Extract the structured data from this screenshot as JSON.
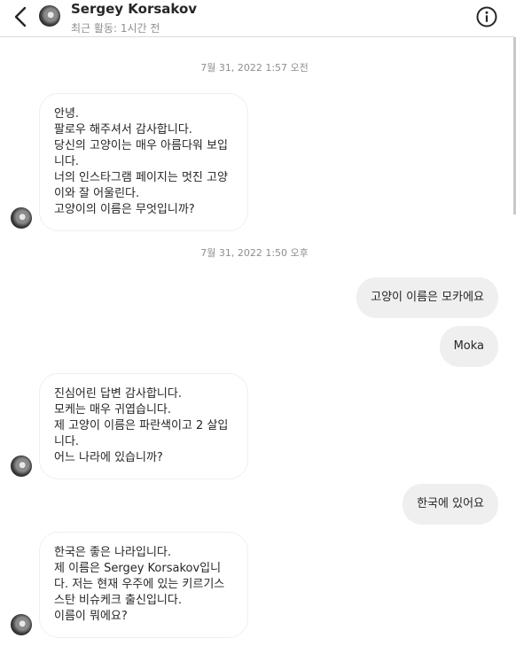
{
  "header": {
    "name": "Sergey Korsakov",
    "status": "최근 활동: 1시간 전",
    "icons": [
      "chevron-left-icon",
      "info-icon"
    ]
  },
  "timestamps": [
    "7월 31, 2022 1:57 오전",
    "7월 31, 2022 1:50 오후"
  ],
  "messages": [
    {
      "sender": "Sergey Korsakov",
      "text": "안녕.\n팔로우 해주셔서 감사합니다.\n당신의 고양이는 매우 아름다워 보입니다.\n너의 인스타그램 페이지는 멋진 고양이와 잘 어울린다.\n고양이의 이름은 무엇입니까?"
    },
    {
      "sender": "me",
      "text": "고양이 이름은 모카에요"
    },
    {
      "sender": "me",
      "text": "Moka"
    },
    {
      "sender": "Sergey Korsakov",
      "text": "진심어린 답변 감사합니다.\n모케는 매우 귀엽습니다.\n제 고양이 이름은 파란색이고 2 살입니다.\n어느 나라에 있습니까?"
    },
    {
      "sender": "me",
      "text": "한국에 있어요"
    },
    {
      "sender": "Sergey Korsakov",
      "text": "한국은 좋은 나라입니다.\n제 이름은 Sergey Korsakov입니다. 저는 현재 우주에 있는 키르기스스탄 비슈케크 출신입니다.\n이름이 뭐에요?"
    }
  ]
}
